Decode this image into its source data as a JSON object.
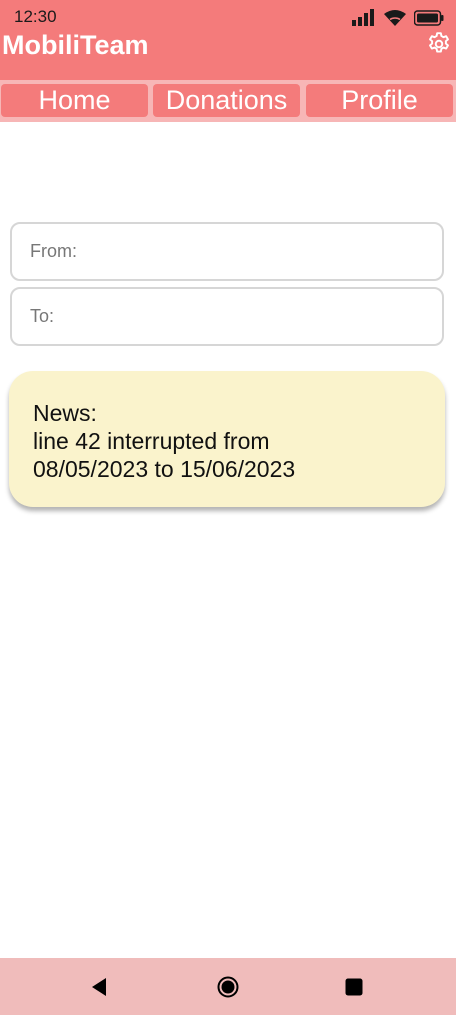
{
  "status_bar": {
    "time": "12:30",
    "icons": [
      "signal-icon",
      "wifi-icon",
      "battery-icon"
    ]
  },
  "app_bar": {
    "title": "MobiliTeam",
    "settings_icon": "gear-icon",
    "background_color": "#f47b7b",
    "title_color": "#ffffff"
  },
  "nav": {
    "tabs": [
      {
        "label": "Home"
      },
      {
        "label": "Donations"
      },
      {
        "label": "Profile"
      }
    ],
    "bar_color": "#f7b6b6",
    "tab_color": "#f47b7b"
  },
  "form": {
    "from_placeholder": "From:",
    "from_value": "",
    "to_placeholder": "To:",
    "to_value": ""
  },
  "news": {
    "heading": "News:",
    "line1": "line 42 interrupted from",
    "line2": "08/05/2023 to 15/06/2023",
    "background_color": "#faf3cc"
  },
  "system_nav": {
    "buttons": [
      "back-icon",
      "home-icon",
      "recents-icon"
    ],
    "background_color": "#f0bcbb"
  }
}
